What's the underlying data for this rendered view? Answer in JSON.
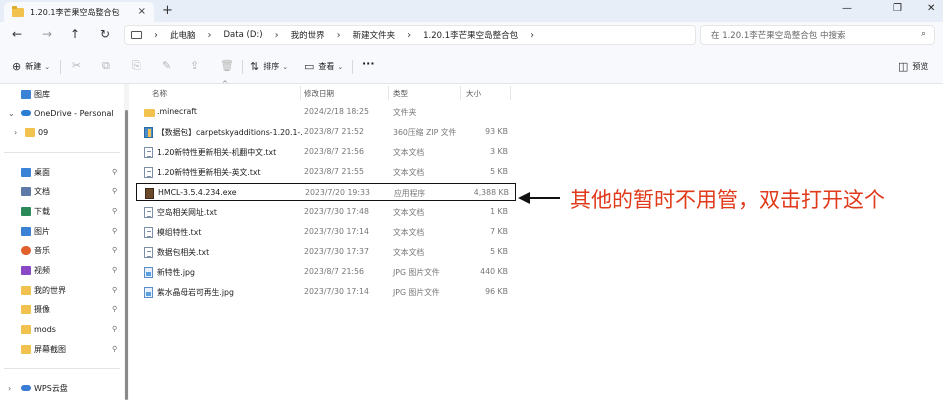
{
  "window": {
    "tab_title": "1.20.1李芒果空岛整合包",
    "tab_close": "×",
    "tab_add": "+",
    "minimize": "—",
    "restore": "❐",
    "close": "✕"
  },
  "nav": {
    "back": "←",
    "forward": "→",
    "up": "↑",
    "refresh": "↻",
    "breadcrumb": [
      "此电脑",
      "Data (D:)",
      "我的世界",
      "新建文件夹",
      "1.20.1李芒果空岛整合包"
    ],
    "sep": "›",
    "search_placeholder": "在 1.20.1李芒果空岛整合包 中搜索",
    "search_icon": "⌕"
  },
  "commands": {
    "new": "新建",
    "sort": "排序",
    "view": "查看",
    "more": "···",
    "preview": "预览",
    "new_icon": "⊕",
    "sort_icon": "⇅",
    "view_icon": "▭",
    "dropdown": "⌄"
  },
  "sidebar": {
    "items": [
      {
        "label": "图库",
        "icon": "gallery-icon",
        "color": "#3b82d6"
      },
      {
        "label": "OneDrive - Personal",
        "icon": "onedrive-icon",
        "color": "#2b7cd3"
      },
      {
        "label": "09",
        "icon": "folder-icon",
        "color": "#f2c24e"
      },
      {
        "label": "桌面",
        "icon": "desktop-icon",
        "color": "#3b82d6"
      },
      {
        "label": "文档",
        "icon": "documents-icon",
        "color": "#5f7aa8"
      },
      {
        "label": "下载",
        "icon": "download-icon",
        "color": "#2a8a5a"
      },
      {
        "label": "图片",
        "icon": "pictures-icon",
        "color": "#3b82d6"
      },
      {
        "label": "音乐",
        "icon": "music-icon",
        "color": "#e0612c"
      },
      {
        "label": "视频",
        "icon": "videos-icon",
        "color": "#8a47c6"
      },
      {
        "label": "我的世界",
        "icon": "folder-icon",
        "color": "#f2c24e"
      },
      {
        "label": "摄像",
        "icon": "folder-icon",
        "color": "#f2c24e"
      },
      {
        "label": "mods",
        "icon": "folder-icon",
        "color": "#f2c24e"
      },
      {
        "label": "屏幕截图",
        "icon": "folder-icon",
        "color": "#f2c24e"
      },
      {
        "label": "WPS云盘",
        "icon": "wps-cloud-icon",
        "color": "#3a7bd5"
      }
    ],
    "chevron_right": "›",
    "chevron_down": "⌄",
    "pin": "📌"
  },
  "columns": {
    "name": "名称",
    "date": "修改日期",
    "type": "类型",
    "size": "大小",
    "sort_caret": "^"
  },
  "files": [
    {
      "name": ".minecraft",
      "date": "2024/2/18 18:25",
      "type": "文件夹",
      "size": "",
      "icon": "folder-icon"
    },
    {
      "name": "【数据包】carpetskyadditions-1.20.1-...",
      "date": "2023/8/7 21:52",
      "type": "360压缩 ZIP 文件",
      "size": "93 KB",
      "icon": "zip-icon"
    },
    {
      "name": "1.20新特性更新相关-机翻中文.txt",
      "date": "2023/8/7 21:56",
      "type": "文本文档",
      "size": "3 KB",
      "icon": "text-file-icon"
    },
    {
      "name": "1.20新特性更新相关-英文.txt",
      "date": "2023/8/7 21:55",
      "type": "文本文档",
      "size": "5 KB",
      "icon": "text-file-icon"
    },
    {
      "name": "HMCL-3.5.4.234.exe",
      "date": "2023/7/20 19:33",
      "type": "应用程序",
      "size": "4,388 KB",
      "icon": "exe-icon"
    },
    {
      "name": "空岛相关网址.txt",
      "date": "2023/7/30 17:48",
      "type": "文本文档",
      "size": "1 KB",
      "icon": "text-file-icon"
    },
    {
      "name": "模组特性.txt",
      "date": "2023/7/30 17:14",
      "type": "文本文档",
      "size": "7 KB",
      "icon": "text-file-icon"
    },
    {
      "name": "数据包相关.txt",
      "date": "2023/7/30 17:37",
      "type": "文本文档",
      "size": "5 KB",
      "icon": "text-file-icon"
    },
    {
      "name": "新特性.jpg",
      "date": "2023/8/7 21:56",
      "type": "JPG 图片文件",
      "size": "440 KB",
      "icon": "image-file-icon"
    },
    {
      "name": "紫水晶母岩可再生.jpg",
      "date": "2023/7/30 17:14",
      "type": "JPG 图片文件",
      "size": "96 KB",
      "icon": "image-file-icon"
    }
  ],
  "annotation": {
    "text": "其他的暂时不用管，双击打开这个",
    "color": "#e03a1a"
  }
}
